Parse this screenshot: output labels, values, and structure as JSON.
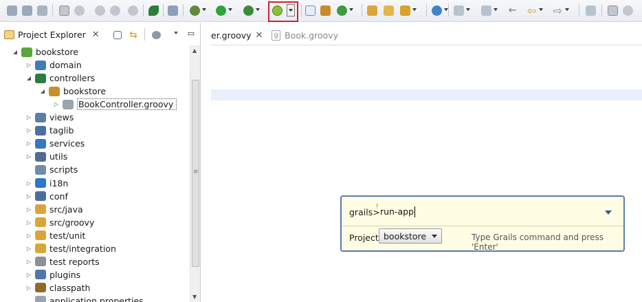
{
  "toolbar": {
    "icons": [
      "save-icon",
      "save-all-icon",
      "print-icon",
      "grails-new-project-icon",
      "pin-icon",
      "new-package-icon",
      "new-class-icon",
      "new-groovy-icon",
      "spring-icon",
      "web-icon",
      "debug-icon",
      "run-icon",
      "external-tools-icon",
      "grails-command-icon",
      "new-file-icon",
      "new-folder-icon",
      "refresh-icon",
      "open-folder-icon",
      "open-file-icon",
      "search-icon",
      "globe-icon",
      "annotation-icon",
      "next-annotation-icon",
      "back-icon",
      "forward-icon",
      "pin-editor-icon",
      "maximize-icon"
    ]
  },
  "explorer": {
    "title": "Project Explorer",
    "close": "✕",
    "tree": [
      {
        "label": "bookstore",
        "level": 0,
        "twisty": "open",
        "icon": "grails-project-icon",
        "color": "#5aa63c"
      },
      {
        "label": "domain",
        "level": 1,
        "twisty": "closed",
        "icon": "domain-icon",
        "color": "#3e7db5"
      },
      {
        "label": "controllers",
        "level": 1,
        "twisty": "open",
        "icon": "controllers-icon",
        "color": "#2b7b42"
      },
      {
        "label": "bookstore",
        "level": 2,
        "twisty": "open",
        "icon": "package-icon",
        "color": "#c8902a"
      },
      {
        "label": "BookController.groovy",
        "level": 3,
        "twisty": "closed",
        "icon": "groovy-file-icon",
        "color": "#9aa4ad",
        "selected": true
      },
      {
        "label": "views",
        "level": 1,
        "twisty": "closed",
        "icon": "views-icon",
        "color": "#5a7fa8"
      },
      {
        "label": "taglib",
        "level": 1,
        "twisty": "closed",
        "icon": "taglib-icon",
        "color": "#4b6fa0"
      },
      {
        "label": "services",
        "level": 1,
        "twisty": "closed",
        "icon": "services-icon",
        "color": "#3577c0"
      },
      {
        "label": "utils",
        "level": 1,
        "twisty": "closed",
        "icon": "utils-icon",
        "color": "#4f6d91"
      },
      {
        "label": "scripts",
        "level": 1,
        "twisty": "none",
        "icon": "scripts-icon",
        "color": "#6f8da8"
      },
      {
        "label": "i18n",
        "level": 1,
        "twisty": "closed",
        "icon": "globe-icon",
        "color": "#2f78c4"
      },
      {
        "label": "conf",
        "level": 1,
        "twisty": "closed",
        "icon": "conf-icon",
        "color": "#4e6e9a"
      },
      {
        "label": "src/java",
        "level": 1,
        "twisty": "closed",
        "icon": "source-folder-icon",
        "color": "#d9a53b"
      },
      {
        "label": "src/groovy",
        "level": 1,
        "twisty": "closed",
        "icon": "source-folder-icon",
        "color": "#d9a53b"
      },
      {
        "label": "test/unit",
        "level": 1,
        "twisty": "closed",
        "icon": "source-folder-icon",
        "color": "#d9a53b"
      },
      {
        "label": "test/integration",
        "level": 1,
        "twisty": "closed",
        "icon": "source-folder-icon",
        "color": "#d9a53b"
      },
      {
        "label": "test reports",
        "level": 1,
        "twisty": "closed",
        "icon": "reports-icon",
        "color": "#8b9099"
      },
      {
        "label": "plugins",
        "level": 1,
        "twisty": "closed",
        "icon": "plugins-icon",
        "color": "#4f77ad"
      },
      {
        "label": "classpath",
        "level": 1,
        "twisty": "closed",
        "icon": "classpath-icon",
        "color": "#8f6b2e"
      },
      {
        "label": "application.properties",
        "level": 1,
        "twisty": "none",
        "icon": "properties-file-icon",
        "color": "#9aa4ad"
      }
    ]
  },
  "editor": {
    "tabs": [
      {
        "label": "er.groovy",
        "close": "✕",
        "active": true
      },
      {
        "label": "Book.groovy",
        "active": false
      }
    ]
  },
  "command_prompt": {
    "label": "grails>",
    "value": "run-app",
    "project_label": "Project:",
    "project_value": "bookstore",
    "message": "Type Grails command and press 'Enter'",
    "border_color": "#5b7ca8",
    "background": "#fffde4"
  },
  "highlight_color": "#d71f27"
}
